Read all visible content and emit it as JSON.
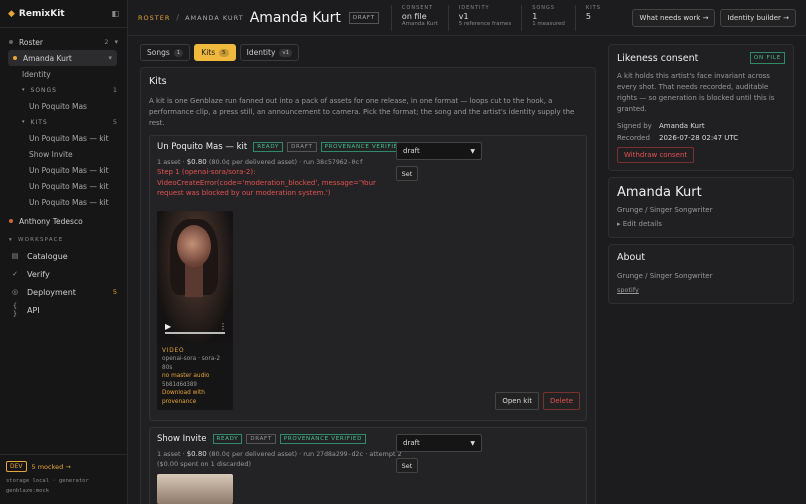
{
  "app": {
    "logo_glyph": "◆",
    "name": "RemixKit",
    "collapse_glyph": "◧"
  },
  "sidebar": {
    "roster_label": "Roster",
    "roster_count": "2",
    "artist1": "Amanda Kurt",
    "identity_label": "Identity",
    "songs_label": "SONGS",
    "songs_count": "1",
    "song1": "Un Poquito Mas",
    "kits_label": "KITS",
    "kits_count": "5",
    "kits": [
      "Un Poquito Mas — kit",
      "Show Invite",
      "Un Poquito Mas — kit",
      "Un Poquito Mas — kit",
      "Un Poquito Mas — kit"
    ],
    "artist2": "Anthony Tedesco",
    "workspace_label": "WORKSPACE",
    "workspace": [
      {
        "label": "Catalogue",
        "icon": "▤",
        "count": ""
      },
      {
        "label": "Verify",
        "icon": "✓",
        "count": ""
      },
      {
        "label": "Deployment",
        "icon": "◎",
        "count": "5"
      },
      {
        "label": "API",
        "icon": "{ }",
        "count": ""
      }
    ],
    "footer": {
      "dev": "DEV",
      "mocked": "5 mocked →",
      "storage": "storage local · generator",
      "genblaze": "genblaze:mock"
    }
  },
  "topbar": {
    "crumb": "ROSTER",
    "crumb_sep": "/",
    "crumb_artist": "AMANDA KURT",
    "title": "Amanda Kurt",
    "status": "DRAFT",
    "metas": [
      {
        "label": "CONSENT",
        "value": "on file",
        "sub": "Amanda Kurt"
      },
      {
        "label": "IDENTITY",
        "value": "v1",
        "sub": "5 reference frames"
      },
      {
        "label": "SONGS",
        "value": "1",
        "sub": "1 measured"
      },
      {
        "label": "KITS",
        "value": "5",
        "sub": ""
      }
    ],
    "btn_work": "What needs work →",
    "btn_builder": "Identity builder →"
  },
  "tabs": [
    {
      "label": "Songs",
      "count": "1"
    },
    {
      "label": "Kits",
      "count": "5"
    },
    {
      "label": "Identity",
      "count": "v1"
    }
  ],
  "kits_panel": {
    "title": "Kits",
    "desc": "A kit is one Genblaze run fanned out into a pack of assets for one release, in one format — loops cut to the hook, a performance clip, a press still, an announcement to camera. Pick the format; the song and the artist's identity supply the rest.",
    "kit1": {
      "name": "Un Poquito Mas — kit",
      "badges": [
        "READY",
        "DRAFT",
        "PROVENANCE VERIFIED"
      ],
      "assets": "1 asset ·",
      "price": "$0.80",
      "price_note": "(80.0¢ per delivered asset) · run",
      "run": "38c57962-0cf",
      "error": "Step 1 (openai-sora/sora-2): VideoCreateError(code='moderation_blocked', message='Your request was blocked by our moderation system.')",
      "select": "draft",
      "set": "Set",
      "card": {
        "type": "VIDEO",
        "model": "openai-sora · sora-2",
        "duration": "80s",
        "audio": "no master audio",
        "hash": "5b81d6d389",
        "download": "Download with provenance",
        "play": "▶",
        "more": "⋮"
      },
      "open": "Open kit",
      "delete": "Delete"
    },
    "kit2": {
      "name": "Show Invite",
      "badges": [
        "READY",
        "DRAFT",
        "PROVENANCE VERIFIED"
      ],
      "assets": "1 asset ·",
      "price": "$0.80",
      "price_note": "(80.0¢ per delivered asset) · run",
      "run": "27d8a299-d2c",
      "attempt": "· attempt 2",
      "spent": "($0.00 spent on 1 discarded)",
      "select": "draft",
      "set": "Set"
    }
  },
  "consent": {
    "title": "Likeness consent",
    "badge": "ON FILE",
    "text": "A kit holds this artist's face invariant across every shot. That needs recorded, auditable rights — so generation is blocked until this is granted.",
    "signed_k": "Signed by",
    "signed_v": "Amanda Kurt",
    "recorded_k": "Recorded",
    "recorded_v": "2026-07-28 02:47 UTC",
    "withdraw": "Withdraw consent"
  },
  "profile": {
    "name": "Amanda Kurt",
    "genre": "Grunge / Singer Songwriter",
    "edit": "▸ Edit details"
  },
  "about": {
    "title": "About",
    "genre": "Grunge / Singer Songwriter",
    "link": "spotify"
  }
}
